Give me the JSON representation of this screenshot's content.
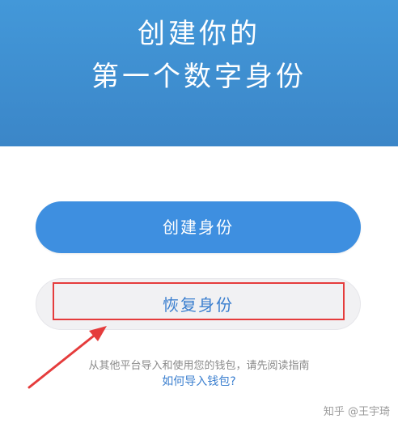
{
  "header": {
    "title_line1": "创建你的",
    "title_line2": "第一个数字身份"
  },
  "buttons": {
    "create_label": "创建身份",
    "restore_label": "恢复身份"
  },
  "footer": {
    "hint": "从其他平台导入和使用您的钱包，请先阅读指南",
    "link": "如何导入钱包?"
  },
  "watermark": "知乎 @王宇琦",
  "colors": {
    "header": "#3b86c8",
    "primary_button": "#3e8fe0",
    "secondary_button": "#f1f1f3",
    "annotation": "#e53c3c",
    "link": "#3b7fcf"
  }
}
